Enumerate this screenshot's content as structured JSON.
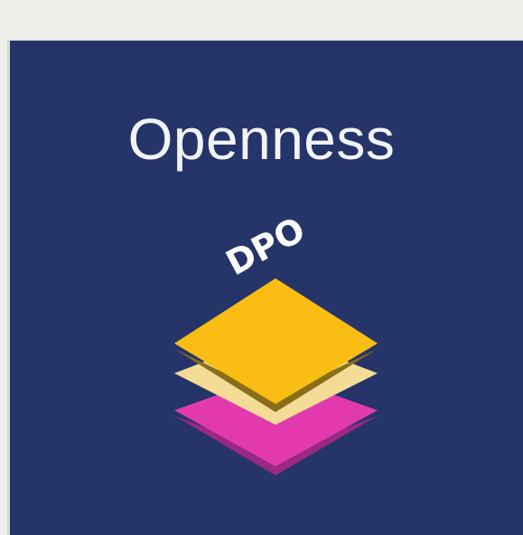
{
  "app": {
    "title": "Openness",
    "badge": "DPO"
  },
  "logo": {
    "name": "stacked-layers-icon",
    "colors": {
      "background": "#253569",
      "top_layer": "#f9bd13",
      "top_layer_shadow": "#8a6d18",
      "middle_layer": "#f5dc96",
      "bottom_layer": "#e23aae",
      "bottom_layer_shadow": "#9b2882",
      "title_text": "#f1f3f6",
      "badge_text": "#ffffff"
    }
  }
}
